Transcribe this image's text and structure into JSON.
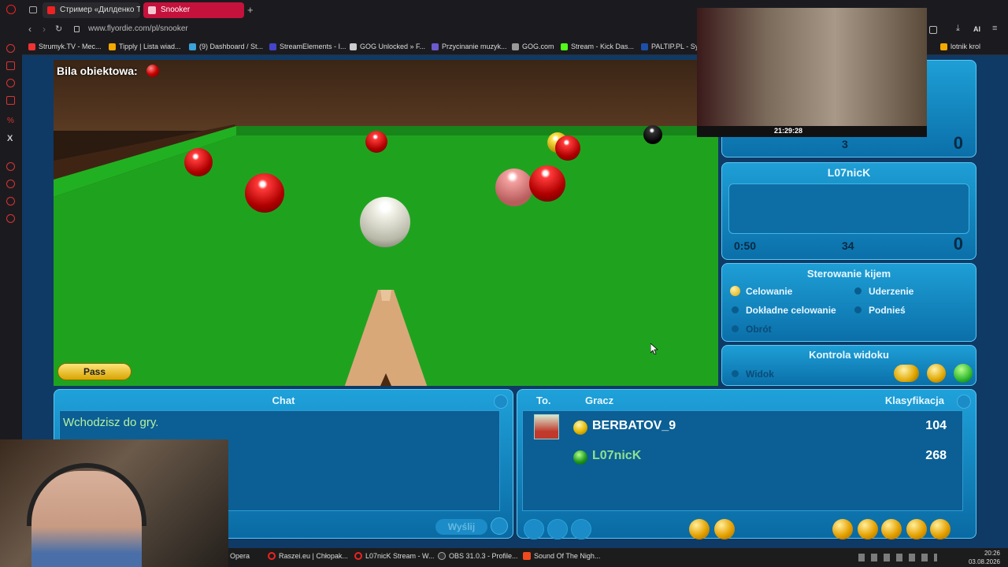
{
  "browser": {
    "tabs": [
      {
        "label": "Стример «Дилденко TV» |",
        "active": false
      },
      {
        "label": "Snooker",
        "active": true
      }
    ],
    "url": "www.flyordie.com/pl/snooker",
    "bookmarks": [
      "Strumyk.TV - Mec...",
      "Tipply | Lista wiad...",
      "(9) Dashboard / St...",
      "StreamElements - I...",
      "GOG Unlocked » F...",
      "Przycinanie muzyk...",
      "GOG.com",
      "Stream - Kick Das...",
      "PALTIP.PL - Sy..."
    ],
    "bookmark_right": "lotnik krol"
  },
  "game": {
    "object_ball_label": "Bila obiektowa:",
    "pass_label": "Pass",
    "colors": {
      "felt": "#1fa31f",
      "panel": "#1ba0d8",
      "gold": "#f2c200"
    }
  },
  "score_panel": {
    "top": {
      "frames": "3",
      "score": "0"
    },
    "player2": {
      "name": "L07nicK",
      "time": "0:50",
      "frames": "34",
      "score": "0"
    }
  },
  "controls": {
    "title": "Sterowanie kijem",
    "options": [
      {
        "label": "Celowanie",
        "active": true
      },
      {
        "label": "Uderzenie",
        "active": false
      },
      {
        "label": "Dokładne celowanie",
        "active": false
      },
      {
        "label": "Podnieś",
        "active": false
      },
      {
        "label": "Obrót",
        "active": false
      }
    ]
  },
  "view": {
    "title": "Kontrola widoku",
    "option": "Widok"
  },
  "chat": {
    "title": "Chat",
    "message": "Wchodzisz do gry.",
    "send_label": "Wyślij"
  },
  "players": {
    "col_to": "To.",
    "col_player": "Gracz",
    "col_rank": "Klasyfikacja",
    "rows": [
      {
        "name": "BERBATOV_9",
        "rank": "104",
        "ball": "yellow",
        "name_color": "#ffffff"
      },
      {
        "name": "L07nicK",
        "rank": "268",
        "ball": "green",
        "name_color": "#8fe08f"
      }
    ]
  },
  "taskbar": {
    "items": [
      "Opera",
      "Raszei.eu | Chłopak...",
      "L07nicK Stream - W...",
      "OBS 31.0.3 - Profile...",
      "Sound Of The Nigh..."
    ],
    "time": "20:26",
    "date": "03.08.2026"
  },
  "overlay": {
    "time": "21:29:28"
  }
}
